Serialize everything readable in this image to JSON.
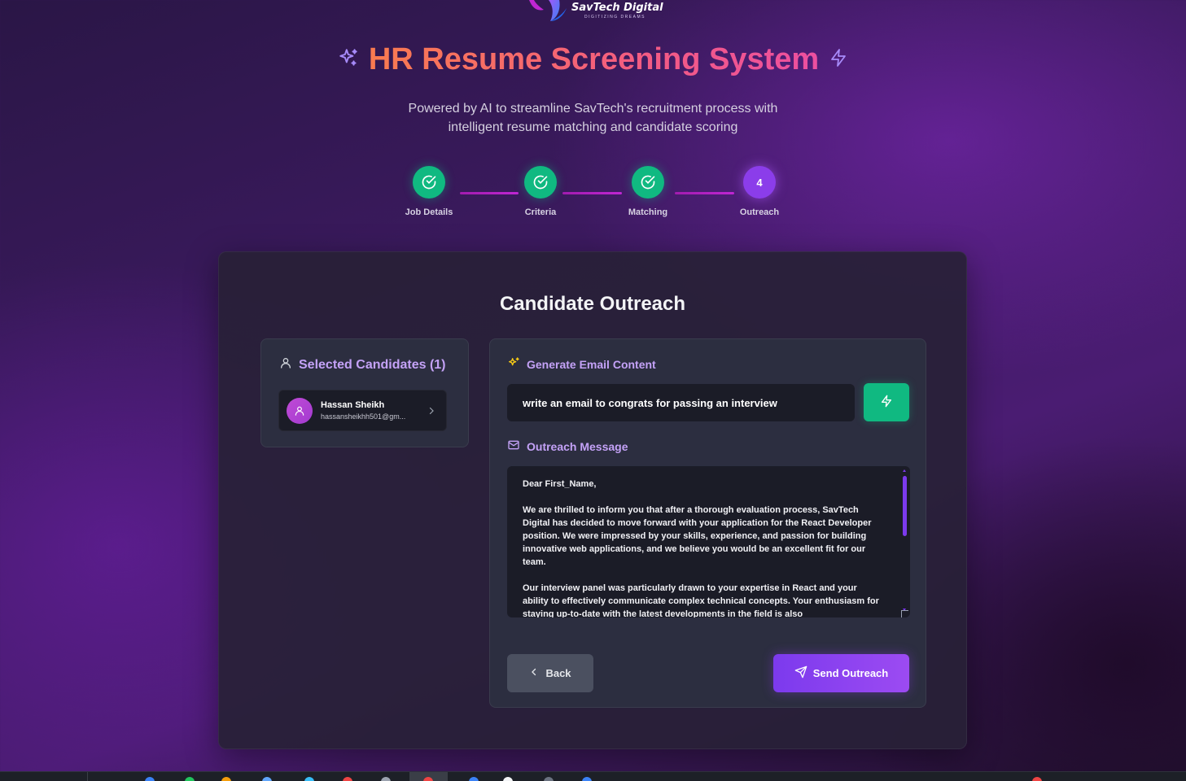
{
  "brand": {
    "name": "SavTech Digital",
    "tagline": "DIGITIZING DREAMS"
  },
  "header": {
    "title": "HR Resume Screening System",
    "subtitle_line1": "Powered by AI to streamline SavTech's recruitment process with",
    "subtitle_line2": "intelligent resume matching and candidate scoring"
  },
  "steps": [
    {
      "label": "Job Details",
      "status": "done"
    },
    {
      "label": "Criteria",
      "status": "done"
    },
    {
      "label": "Matching",
      "status": "done"
    },
    {
      "label": "Outreach",
      "status": "current",
      "number": "4"
    }
  ],
  "card": {
    "title": "Candidate Outreach"
  },
  "selected": {
    "heading": "Selected Candidates (1)",
    "candidates": [
      {
        "name": "Hassan Sheikh",
        "email": "hassansheikhh501@gm..."
      }
    ]
  },
  "generate": {
    "heading": "Generate Email Content",
    "prompt_value": "write an email to congrats for passing an interview"
  },
  "outreach": {
    "heading": "Outreach Message",
    "paragraphs": [
      "Dear First_Name,",
      "We are thrilled to inform you that after a thorough evaluation process, SavTech Digital has decided to move forward with your application for the React Developer position. We were impressed by your skills, experience, and passion for building innovative web applications, and we believe you would be an excellent fit for our team.",
      "Our interview panel was particularly drawn to your expertise in React and your ability to effectively communicate complex technical concepts. Your enthusiasm for staying up-to-date with the latest developments in the field is also"
    ]
  },
  "actions": {
    "back_label": "Back",
    "send_label": "Send Outreach"
  },
  "colors": {
    "accent_purple": "#8b3dea",
    "success_green": "#10b981",
    "heading_lavender": "#c4a2f7",
    "title_gradient_start": "#f97b4f",
    "title_gradient_end": "#ec4fa0"
  }
}
